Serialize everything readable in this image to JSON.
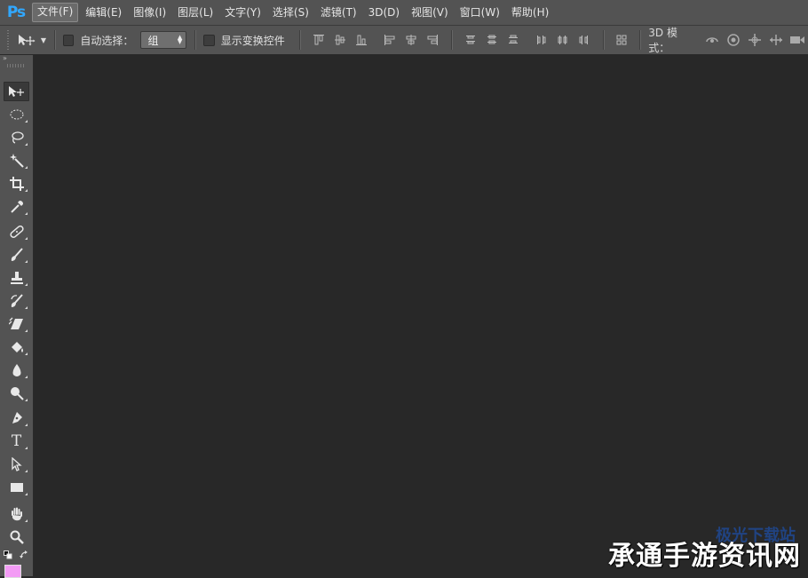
{
  "app": {
    "logo": "Ps"
  },
  "menu": [
    {
      "label": "文件(F)",
      "active": true
    },
    {
      "label": "编辑(E)"
    },
    {
      "label": "图像(I)"
    },
    {
      "label": "图层(L)"
    },
    {
      "label": "文字(Y)"
    },
    {
      "label": "选择(S)"
    },
    {
      "label": "滤镜(T)"
    },
    {
      "label": "3D(D)"
    },
    {
      "label": "视图(V)"
    },
    {
      "label": "窗口(W)"
    },
    {
      "label": "帮助(H)"
    }
  ],
  "options": {
    "auto_select_label": "自动选择：",
    "auto_select_checked": false,
    "auto_select_value": "组",
    "show_transform_label": "显示变换控件",
    "show_transform_checked": false,
    "mode_3d_label": "3D 模式："
  },
  "toolbox": {
    "collapse_glyph": "»",
    "tools": [
      {
        "name": "move-tool",
        "icon": "move-icon",
        "active": true
      },
      {
        "name": "elliptical-marquee-tool",
        "icon": "ellipse-marquee-icon"
      },
      {
        "name": "lasso-tool",
        "icon": "lasso-icon"
      },
      {
        "name": "magic-wand-tool",
        "icon": "magic-wand-icon"
      },
      {
        "name": "crop-tool",
        "icon": "crop-icon"
      },
      {
        "name": "eyedropper-tool",
        "icon": "eyedropper-icon"
      },
      {
        "name": "healing-brush-tool",
        "icon": "bandage-icon"
      },
      {
        "name": "brush-tool",
        "icon": "brush-icon"
      },
      {
        "name": "clone-stamp-tool",
        "icon": "stamp-icon"
      },
      {
        "name": "history-brush-tool",
        "icon": "history-brush-icon"
      },
      {
        "name": "eraser-tool",
        "icon": "eraser-icon"
      },
      {
        "name": "paint-bucket-tool",
        "icon": "paint-bucket-icon"
      },
      {
        "name": "blur-tool",
        "icon": "drop-icon"
      },
      {
        "name": "dodge-tool",
        "icon": "dodge-icon"
      },
      {
        "name": "pen-tool",
        "icon": "pen-icon"
      },
      {
        "name": "type-tool",
        "icon": "type-icon",
        "glyph": "T"
      },
      {
        "name": "path-selection-tool",
        "icon": "path-select-icon"
      },
      {
        "name": "rectangle-tool",
        "icon": "rectangle-icon"
      },
      {
        "name": "hand-tool",
        "icon": "hand-icon"
      },
      {
        "name": "zoom-tool",
        "icon": "zoom-icon"
      }
    ],
    "foreground_color": "#f39bf5"
  },
  "watermark": {
    "text": "承通手游资讯网",
    "back_text": "极光下载站"
  },
  "colors": {
    "chrome": "#535353",
    "canvas": "#282828",
    "logo": "#31a8ff"
  }
}
